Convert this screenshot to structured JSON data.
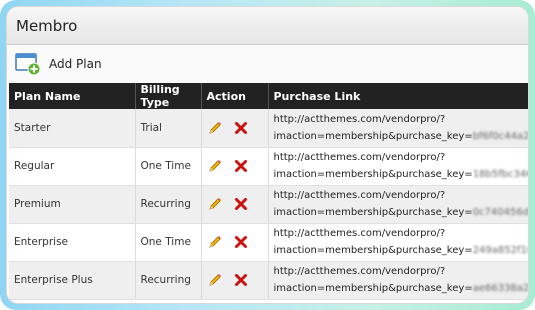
{
  "panel": {
    "title": "Membro"
  },
  "toolbar": {
    "add_plan_label": "Add Plan"
  },
  "table": {
    "columns": [
      "Plan Name",
      "Billing Type",
      "Action",
      "Purchase Link"
    ],
    "rows": [
      {
        "plan": "Starter",
        "billing": "Trial",
        "link_line1": "http://actthemes.com/vendorpro/?",
        "link_line2": "imaction=membership&purchase_key=",
        "key": "bf6f0c44a2"
      },
      {
        "plan": "Regular",
        "billing": "One Time",
        "link_line1": "http://actthemes.com/vendorpro/?",
        "link_line2": "imaction=membership&purchase_key=",
        "key": "18b5fbc346"
      },
      {
        "plan": "Premium",
        "billing": "Recurring",
        "link_line1": "http://actthemes.com/vendorpro/?",
        "link_line2": "imaction=membership&purchase_key=",
        "key": "0c740456d0"
      },
      {
        "plan": "Enterprise",
        "billing": "One Time",
        "link_line1": "http://actthemes.com/vendorpro/?",
        "link_line2": "imaction=membership&purchase_key=",
        "key": "249a852f10"
      },
      {
        "plan": "Enterprise Plus",
        "billing": "Recurring",
        "link_line1": "http://actthemes.com/vendorpro/?",
        "link_line2": "imaction=membership&purchase_key=",
        "key": "ae66338a29"
      }
    ]
  },
  "icons": {
    "edit": "pencil-icon",
    "delete": "close-icon",
    "add": "add-window-icon"
  },
  "colors": {
    "header_bg": "#222222",
    "delete": "#cc1111",
    "pencil": "#e0a100",
    "add_badge": "#5cb531"
  }
}
